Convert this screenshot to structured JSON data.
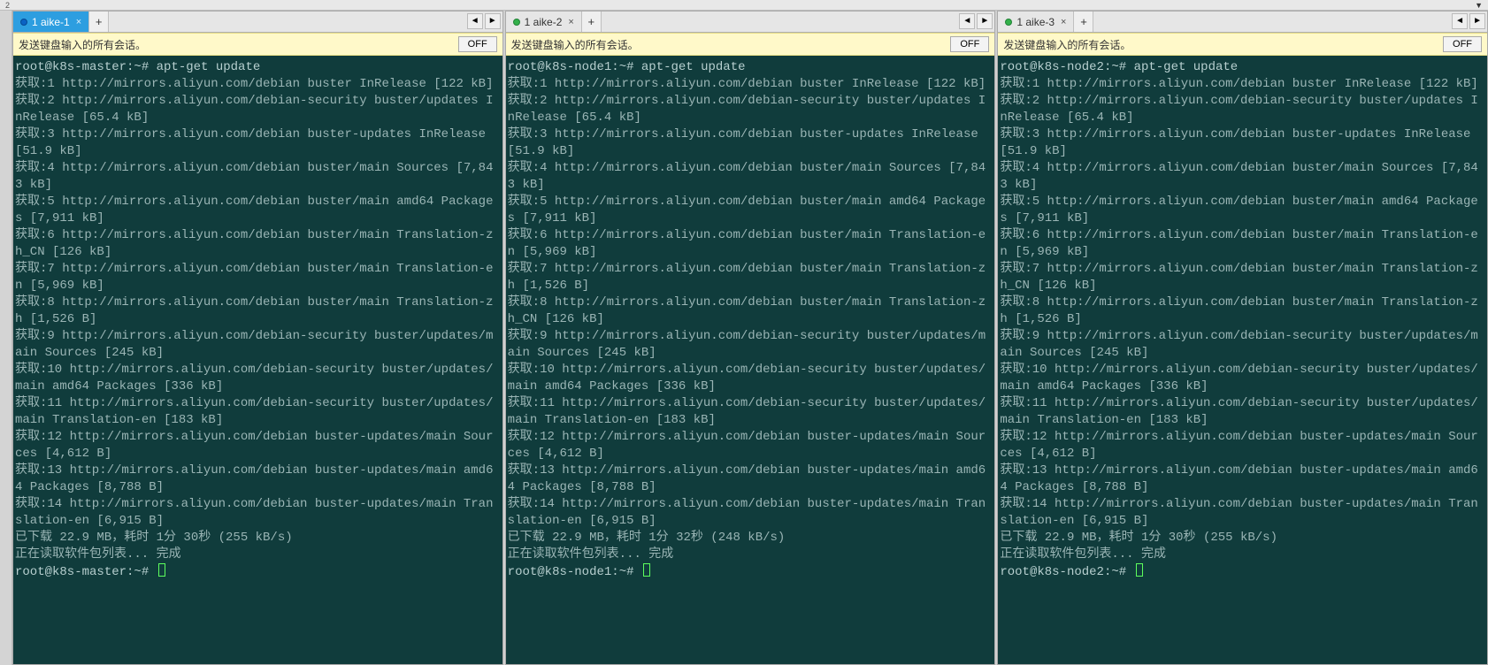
{
  "scale_mark": "2",
  "scale_arrow": "▼",
  "panes": [
    {
      "tab": {
        "label": "1 aike-1",
        "dot": "blue",
        "active_class": "active1"
      },
      "infobar": {
        "msg": "发送键盘输入的所有会话。",
        "btn": "OFF"
      },
      "terminal_lines": [
        "root@k8s-master:~# apt-get update",
        "获取:1 http://mirrors.aliyun.com/debian buster InRelease [122 kB]",
        "获取:2 http://mirrors.aliyun.com/debian-security buster/updates InRelease [65.4 kB]",
        "获取:3 http://mirrors.aliyun.com/debian buster-updates InRelease [51.9 kB]",
        "获取:4 http://mirrors.aliyun.com/debian buster/main Sources [7,843 kB]",
        "获取:5 http://mirrors.aliyun.com/debian buster/main amd64 Packages [7,911 kB]",
        "获取:6 http://mirrors.aliyun.com/debian buster/main Translation-zh_CN [126 kB]",
        "获取:7 http://mirrors.aliyun.com/debian buster/main Translation-en [5,969 kB]",
        "获取:8 http://mirrors.aliyun.com/debian buster/main Translation-zh [1,526 B]",
        "获取:9 http://mirrors.aliyun.com/debian-security buster/updates/main Sources [245 kB]",
        "获取:10 http://mirrors.aliyun.com/debian-security buster/updates/main amd64 Packages [336 kB]",
        "获取:11 http://mirrors.aliyun.com/debian-security buster/updates/main Translation-en [183 kB]",
        "获取:12 http://mirrors.aliyun.com/debian buster-updates/main Sources [4,612 B]",
        "获取:13 http://mirrors.aliyun.com/debian buster-updates/main amd64 Packages [8,788 B]",
        "获取:14 http://mirrors.aliyun.com/debian buster-updates/main Translation-en [6,915 B]",
        "已下载 22.9 MB，耗时 1分 30秒 (255 kB/s)",
        "正在读取软件包列表... 完成",
        "root@k8s-master:~# "
      ]
    },
    {
      "tab": {
        "label": "1 aike-2",
        "dot": "green",
        "active_class": "inactive"
      },
      "infobar": {
        "msg": "发送键盘输入的所有会话。",
        "btn": "OFF"
      },
      "terminal_lines": [
        "root@k8s-node1:~# apt-get update",
        "获取:1 http://mirrors.aliyun.com/debian buster InRelease [122 kB]",
        "获取:2 http://mirrors.aliyun.com/debian-security buster/updates InRelease [65.4 kB]",
        "获取:3 http://mirrors.aliyun.com/debian buster-updates InRelease [51.9 kB]",
        "获取:4 http://mirrors.aliyun.com/debian buster/main Sources [7,843 kB]",
        "获取:5 http://mirrors.aliyun.com/debian buster/main amd64 Packages [7,911 kB]",
        "获取:6 http://mirrors.aliyun.com/debian buster/main Translation-en [5,969 kB]",
        "获取:7 http://mirrors.aliyun.com/debian buster/main Translation-zh [1,526 B]",
        "获取:8 http://mirrors.aliyun.com/debian buster/main Translation-zh_CN [126 kB]",
        "获取:9 http://mirrors.aliyun.com/debian-security buster/updates/main Sources [245 kB]",
        "获取:10 http://mirrors.aliyun.com/debian-security buster/updates/main amd64 Packages [336 kB]",
        "获取:11 http://mirrors.aliyun.com/debian-security buster/updates/main Translation-en [183 kB]",
        "获取:12 http://mirrors.aliyun.com/debian buster-updates/main Sources [4,612 B]",
        "获取:13 http://mirrors.aliyun.com/debian buster-updates/main amd64 Packages [8,788 B]",
        "获取:14 http://mirrors.aliyun.com/debian buster-updates/main Translation-en [6,915 B]",
        "已下载 22.9 MB，耗时 1分 32秒 (248 kB/s)",
        "正在读取软件包列表... 完成",
        "root@k8s-node1:~# "
      ]
    },
    {
      "tab": {
        "label": "1 aike-3",
        "dot": "green",
        "active_class": "inactive"
      },
      "infobar": {
        "msg": "发送键盘输入的所有会话。",
        "btn": "OFF"
      },
      "terminal_lines": [
        "root@k8s-node2:~# apt-get update",
        "获取:1 http://mirrors.aliyun.com/debian buster InRelease [122 kB]",
        "获取:2 http://mirrors.aliyun.com/debian-security buster/updates InRelease [65.4 kB]",
        "获取:3 http://mirrors.aliyun.com/debian buster-updates InRelease [51.9 kB]",
        "获取:4 http://mirrors.aliyun.com/debian buster/main Sources [7,843 kB]",
        "获取:5 http://mirrors.aliyun.com/debian buster/main amd64 Packages [7,911 kB]",
        "获取:6 http://mirrors.aliyun.com/debian buster/main Translation-en [5,969 kB]",
        "获取:7 http://mirrors.aliyun.com/debian buster/main Translation-zh_CN [126 kB]",
        "获取:8 http://mirrors.aliyun.com/debian buster/main Translation-zh [1,526 B]",
        "获取:9 http://mirrors.aliyun.com/debian-security buster/updates/main Sources [245 kB]",
        "获取:10 http://mirrors.aliyun.com/debian-security buster/updates/main amd64 Packages [336 kB]",
        "获取:11 http://mirrors.aliyun.com/debian-security buster/updates/main Translation-en [183 kB]",
        "获取:12 http://mirrors.aliyun.com/debian buster-updates/main Sources [4,612 B]",
        "获取:13 http://mirrors.aliyun.com/debian buster-updates/main amd64 Packages [8,788 B]",
        "获取:14 http://mirrors.aliyun.com/debian buster-updates/main Translation-en [6,915 B]",
        "已下载 22.9 MB，耗时 1分 30秒 (255 kB/s)",
        "正在读取软件包列表... 完成",
        "root@k8s-node2:~# "
      ]
    }
  ],
  "nav": {
    "prev": "◄",
    "next": "►",
    "close": "×",
    "add": "+"
  }
}
